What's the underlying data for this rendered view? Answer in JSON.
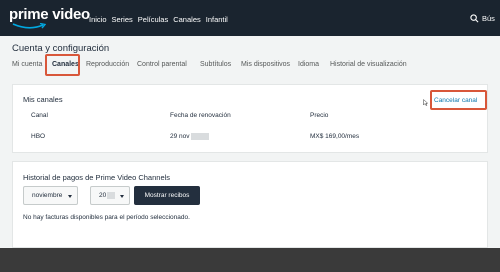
{
  "brand": {
    "logo_text": "prime video",
    "accent": "#00a8e1",
    "header_bg": "#1a242f"
  },
  "nav": {
    "items": [
      "Inicio",
      "Series",
      "Películas",
      "Canales",
      "Infantil"
    ],
    "search_label": "Bús"
  },
  "page": {
    "title": "Cuenta y configuración",
    "tabs": [
      "Mi cuenta",
      "Canales",
      "Reproducción",
      "Control parental",
      "Subtítulos",
      "Mis dispositivos",
      "Idioma",
      "Historial de visualización"
    ],
    "active_tab": "Canales"
  },
  "channels": {
    "title": "Mis canales",
    "headers": {
      "channel": "Canal",
      "renewal": "Fecha de renovación",
      "price": "Precio"
    },
    "rows": [
      {
        "channel": "HBO",
        "renewal": "29 nov",
        "price": "MX$ 169,00/mes",
        "action": "Cancelar canal"
      }
    ]
  },
  "payments": {
    "title": "Historial de pagos de Prime Video Channels",
    "month": "noviembre",
    "year": "20",
    "button": "Mostrar recibos",
    "empty_message": "No hay facturas disponibles para el período seleccionado."
  },
  "highlight_color": "#d8573a",
  "link_color": "#0f79af"
}
